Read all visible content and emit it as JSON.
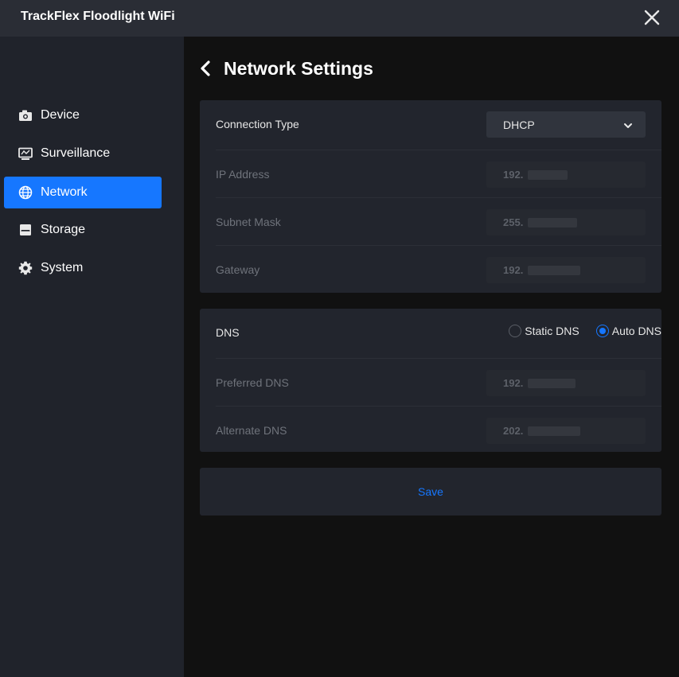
{
  "app": {
    "title": "TrackFlex Floodlight WiFi",
    "close_icon": "close-icon"
  },
  "sidebar": {
    "items": [
      {
        "label": "Device",
        "icon": "camera-icon",
        "active": false
      },
      {
        "label": "Surveillance",
        "icon": "monitor-icon",
        "active": false
      },
      {
        "label": "Network",
        "icon": "globe-icon",
        "active": true
      },
      {
        "label": "Storage",
        "icon": "storage-icon",
        "active": false
      },
      {
        "label": "System",
        "icon": "gear-icon",
        "active": false
      }
    ]
  },
  "page": {
    "title": "Network Settings",
    "back_icon": "chevron-left-icon"
  },
  "connection": {
    "type_label": "Connection Type",
    "type_value": "DHCP",
    "ip_label": "IP Address",
    "ip_value": "192.",
    "subnet_label": "Subnet Mask",
    "subnet_value": "255.",
    "gateway_label": "Gateway",
    "gateway_value": "192."
  },
  "dns": {
    "label": "DNS",
    "option_static": "Static DNS",
    "option_auto": "Auto DNS",
    "selected": "Auto DNS",
    "preferred_label": "Preferred DNS",
    "preferred_value": "192.",
    "alternate_label": "Alternate DNS",
    "alternate_value": "202."
  },
  "actions": {
    "save_label": "Save"
  },
  "colors": {
    "accent": "#1677ff",
    "titlebar": "#2a2d35",
    "sidebar": "#20232b",
    "card": "#22252d",
    "background": "#111111"
  }
}
